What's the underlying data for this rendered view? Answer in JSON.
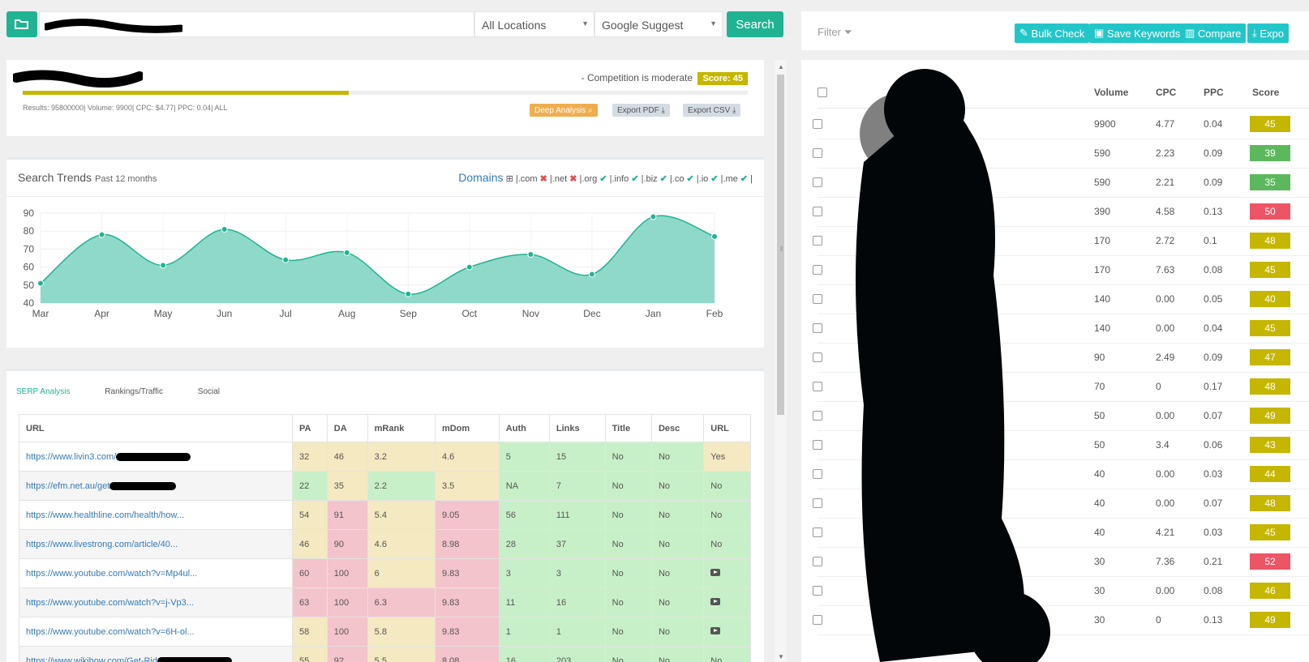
{
  "toolbar": {
    "location": "All Locations",
    "source": "Google Suggest",
    "search_label": "Search"
  },
  "summary": {
    "competition": "- Competition is moderate",
    "score": "Score: 45",
    "progress": 0.45,
    "stats": "Results: 95800000| Volume: 9900| CPC: $4.77| PPC: 0.04| ALL",
    "deep_analysis": "Deep Analysis",
    "export_pdf": "Export PDF",
    "export_csv": "Export CSV"
  },
  "trends": {
    "title": "Search Trends",
    "subtitle": "Past 12 months",
    "domains_title": "Domains",
    "domains": [
      {
        "tld": ".com",
        "available": false
      },
      {
        "tld": ".net",
        "available": false
      },
      {
        "tld": ".org",
        "available": true
      },
      {
        "tld": ".info",
        "available": true
      },
      {
        "tld": ".biz",
        "available": true
      },
      {
        "tld": ".co",
        "available": true
      },
      {
        "tld": ".io",
        "available": true
      },
      {
        "tld": ".me",
        "available": true
      }
    ]
  },
  "chart_data": {
    "type": "area",
    "x": [
      "Mar",
      "Apr",
      "May",
      "Jun",
      "Jul",
      "Aug",
      "Sep",
      "Oct",
      "Nov",
      "Dec",
      "Jan",
      "Feb"
    ],
    "values": [
      51,
      78,
      61,
      81,
      64,
      68,
      45,
      60,
      67,
      56,
      88,
      77
    ],
    "ylim": [
      40,
      90
    ],
    "yticks": [
      40,
      50,
      60,
      70,
      80,
      90
    ],
    "grid": true,
    "color": "#1fb394",
    "fill": "#8fd9c8"
  },
  "serp": {
    "tabs": [
      "SERP Analysis",
      "Rankings/Traffic",
      "Social"
    ],
    "columns": [
      "URL",
      "PA",
      "DA",
      "mRank",
      "mDom",
      "Auth",
      "Links",
      "Title",
      "Desc",
      "URL"
    ],
    "rows": [
      {
        "url": "https://www.livin3.com/",
        "cells": [
          "32",
          "46",
          "3.2",
          "4.6",
          "5",
          "15",
          "No",
          "No",
          "Yes"
        ],
        "colors": [
          "y",
          "y",
          "y",
          "y",
          "g",
          "g",
          "g",
          "g",
          "y"
        ]
      },
      {
        "url": "https://efm.net.au/get",
        "cells": [
          "22",
          "35",
          "2.2",
          "3.5",
          "NA",
          "7",
          "No",
          "No",
          "No"
        ],
        "colors": [
          "g",
          "y",
          "g",
          "y",
          "g",
          "g",
          "g",
          "g",
          "g"
        ]
      },
      {
        "url": "https://www.healthline.com/health/how...",
        "cells": [
          "54",
          "91",
          "5.4",
          "9.05",
          "56",
          "111",
          "No",
          "No",
          "No"
        ],
        "colors": [
          "y",
          "r",
          "y",
          "r",
          "g",
          "g",
          "g",
          "g",
          "g"
        ]
      },
      {
        "url": "https://www.livestrong.com/article/40...",
        "cells": [
          "46",
          "90",
          "4.6",
          "8.98",
          "28",
          "37",
          "No",
          "No",
          "No"
        ],
        "colors": [
          "y",
          "r",
          "y",
          "r",
          "g",
          "g",
          "g",
          "g",
          "g"
        ]
      },
      {
        "url": "https://www.youtube.com/watch?v=Mp4ul...",
        "cells": [
          "60",
          "100",
          "6",
          "9.83",
          "3",
          "3",
          "No",
          "No",
          ""
        ],
        "colors": [
          "r",
          "r",
          "y",
          "r",
          "g",
          "g",
          "g",
          "g",
          "g"
        ]
      },
      {
        "url": "https://www.youtube.com/watch?v=j-Vp3...",
        "cells": [
          "63",
          "100",
          "6.3",
          "9.83",
          "11",
          "16",
          "No",
          "No",
          ""
        ],
        "colors": [
          "r",
          "r",
          "r",
          "r",
          "g",
          "g",
          "g",
          "g",
          "g"
        ]
      },
      {
        "url": "https://www.youtube.com/watch?v=6H-ol...",
        "cells": [
          "58",
          "100",
          "5.8",
          "9.83",
          "1",
          "1",
          "No",
          "No",
          ""
        ],
        "colors": [
          "y",
          "r",
          "y",
          "r",
          "g",
          "g",
          "g",
          "g",
          "g"
        ]
      },
      {
        "url": "https://www.wikihow.com/Get-Rid",
        "cells": [
          "55",
          "92",
          "5.5",
          "8.08",
          "16",
          "203",
          "No",
          "No",
          "No"
        ],
        "colors": [
          "y",
          "r",
          "y",
          "r",
          "g",
          "g",
          "g",
          "g",
          "g"
        ]
      }
    ]
  },
  "right": {
    "filter": "Filter",
    "buttons": [
      "Bulk Check",
      "Save Keywords",
      "Compare",
      "Expo"
    ],
    "headers": [
      "Volume",
      "CPC",
      "PPC",
      "Score"
    ],
    "rows": [
      {
        "volume": "9900",
        "cpc": "4.77",
        "ppc": "0.04",
        "score": "45",
        "color": "#c5b600"
      },
      {
        "volume": "590",
        "cpc": "2.23",
        "ppc": "0.09",
        "score": "39",
        "color": "#5cb85c"
      },
      {
        "volume": "590",
        "cpc": "2.21",
        "ppc": "0.09",
        "score": "35",
        "color": "#5cb85c"
      },
      {
        "volume": "390",
        "cpc": "4.58",
        "ppc": "0.13",
        "score": "50",
        "color": "#ed5565"
      },
      {
        "volume": "170",
        "cpc": "2.72",
        "ppc": "0.1",
        "score": "48",
        "color": "#c5b600"
      },
      {
        "volume": "170",
        "cpc": "7.63",
        "ppc": "0.08",
        "score": "45",
        "color": "#c5b600"
      },
      {
        "volume": "140",
        "cpc": "0.00",
        "ppc": "0.05",
        "score": "40",
        "color": "#c5b600"
      },
      {
        "volume": "140",
        "cpc": "0.00",
        "ppc": "0.04",
        "score": "45",
        "color": "#c5b600"
      },
      {
        "volume": "90",
        "cpc": "2.49",
        "ppc": "0.09",
        "score": "47",
        "color": "#c5b600"
      },
      {
        "volume": "70",
        "cpc": "0",
        "ppc": "0.17",
        "score": "48",
        "color": "#c5b600"
      },
      {
        "volume": "50",
        "cpc": "0.00",
        "ppc": "0.07",
        "score": "49",
        "color": "#c5b600"
      },
      {
        "volume": "50",
        "cpc": "3.4",
        "ppc": "0.06",
        "score": "43",
        "color": "#c5b600"
      },
      {
        "volume": "40",
        "cpc": "0.00",
        "ppc": "0.03",
        "score": "44",
        "color": "#c5b600"
      },
      {
        "volume": "40",
        "cpc": "0.00",
        "ppc": "0.07",
        "score": "48",
        "color": "#c5b600"
      },
      {
        "volume": "40",
        "cpc": "4.21",
        "ppc": "0.03",
        "score": "45",
        "color": "#c5b600"
      },
      {
        "volume": "30",
        "cpc": "7.36",
        "ppc": "0.21",
        "score": "52",
        "color": "#ed5565"
      },
      {
        "volume": "30",
        "cpc": "0.00",
        "ppc": "0.08",
        "score": "46",
        "color": "#c5b600"
      },
      {
        "volume": "30",
        "cpc": "0",
        "ppc": "0.13",
        "score": "49",
        "color": "#c5b600"
      }
    ]
  }
}
